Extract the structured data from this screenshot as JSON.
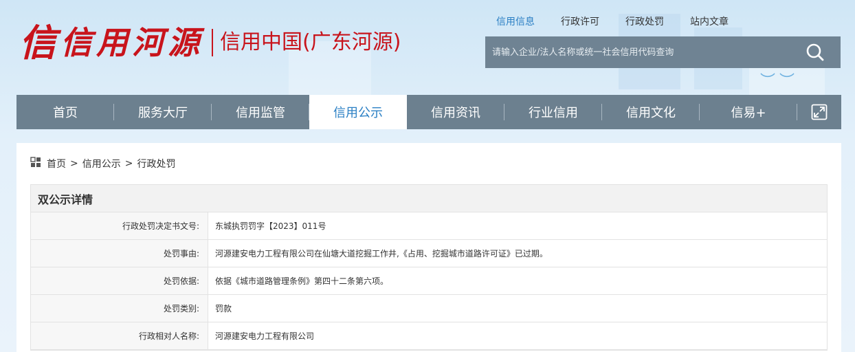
{
  "header": {
    "logo_mark": "信",
    "logo_name": "信用河源",
    "logo_text": "信用中国(广东河源)",
    "top_links": [
      {
        "label": "信用信息",
        "active": true
      },
      {
        "label": "行政许可",
        "active": false
      },
      {
        "label": "行政处罚",
        "active": false
      },
      {
        "label": "站内文章",
        "active": false
      }
    ],
    "search": {
      "placeholder": "请输入企业/法人名称或统一社会信用代码查询",
      "icon": "search-icon"
    }
  },
  "nav": {
    "items": [
      {
        "label": "首页",
        "active": false
      },
      {
        "label": "服务大厅",
        "active": false
      },
      {
        "label": "信用监管",
        "active": false
      },
      {
        "label": "信用公示",
        "active": true
      },
      {
        "label": "信用资讯",
        "active": false
      },
      {
        "label": "行业信用",
        "active": false
      },
      {
        "label": "信用文化",
        "active": false
      },
      {
        "label": "信易+",
        "active": false
      }
    ],
    "expand_icon": "expand-icon"
  },
  "breadcrumb": {
    "icon": "grid-icon",
    "items": [
      "首页",
      "信用公示",
      "行政处罚"
    ],
    "separator": ">"
  },
  "detail": {
    "title": "双公示详情",
    "rows": [
      {
        "label": "行政处罚决定书文号:",
        "value": "东城执罚罚字【2023】011号"
      },
      {
        "label": "处罚事由:",
        "value": "河源建安电力工程有限公司在仙塘大道挖掘工作井,《占用、挖掘城市道路许可证》已过期。"
      },
      {
        "label": "处罚依据:",
        "value": "依据《城市道路管理条例》第四十二条第六项。"
      },
      {
        "label": "处罚类别:",
        "value": "罚款"
      },
      {
        "label": "行政相对人名称:",
        "value": "河源建安电力工程有限公司"
      }
    ]
  },
  "colors": {
    "brand_red": "#c8141c",
    "nav_bg": "#6c808f",
    "accent_blue": "#2a7fc4"
  }
}
